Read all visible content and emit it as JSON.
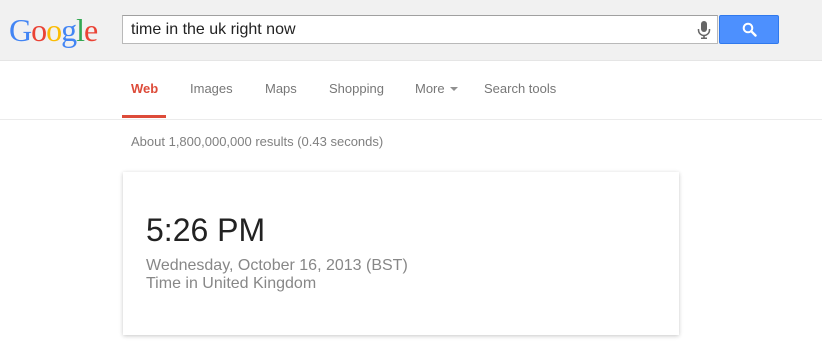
{
  "logo": {
    "letters": [
      "G",
      "o",
      "o",
      "g",
      "l",
      "e"
    ],
    "colors": [
      "#4285f4",
      "#ea4335",
      "#fbbc05",
      "#4285f4",
      "#34a853",
      "#ea4335"
    ]
  },
  "search": {
    "query": "time in the uk right now",
    "mic_icon": "microphone-icon",
    "search_icon": "magnifier-icon",
    "button_color": "#4d90fe"
  },
  "tabs": [
    {
      "label": "Web",
      "active": true
    },
    {
      "label": "Images",
      "active": false
    },
    {
      "label": "Maps",
      "active": false
    },
    {
      "label": "Shopping",
      "active": false
    },
    {
      "label": "More",
      "active": false,
      "dropdown": true
    },
    {
      "label": "Search tools",
      "active": false
    }
  ],
  "accent_color": "#dd4b39",
  "results": {
    "stats": "About 1,800,000,000 results (0.43 seconds)"
  },
  "time_card": {
    "time": "5:26 PM",
    "date": "Wednesday, October 16, 2013 (BST)",
    "location": "Time in United Kingdom"
  }
}
